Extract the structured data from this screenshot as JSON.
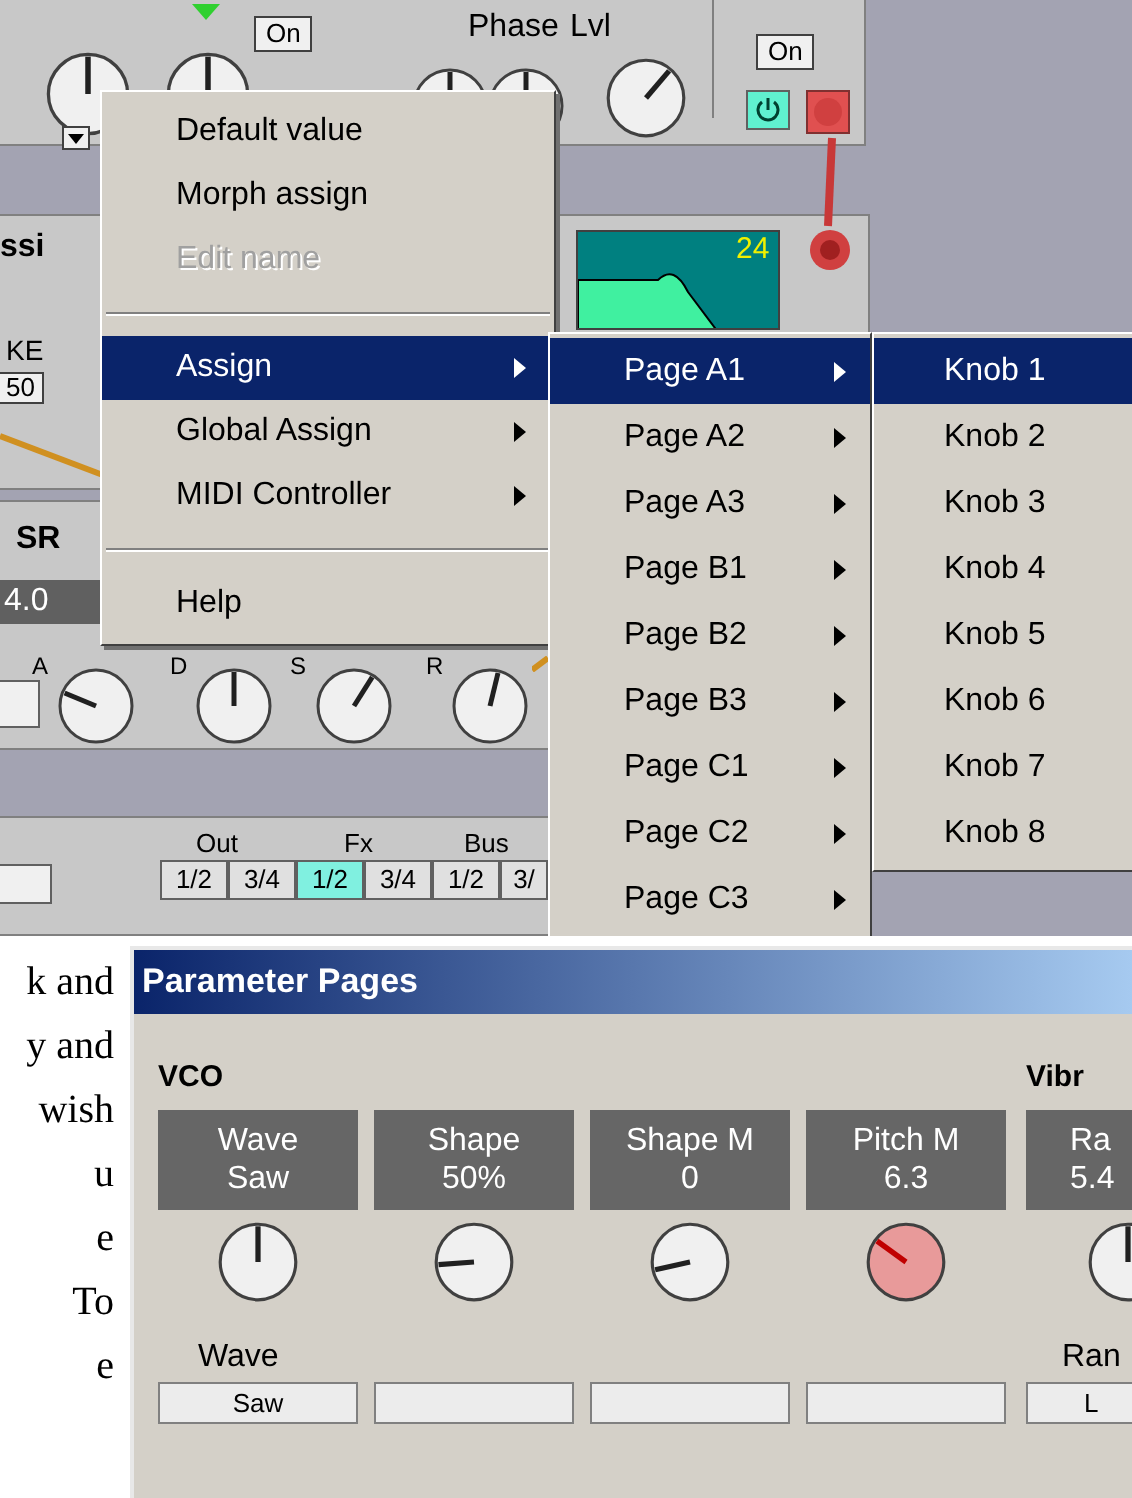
{
  "patch": {
    "osc_module": {
      "buttons": [
        {
          "label": "On"
        },
        {
          "label": "On"
        }
      ],
      "labels": [
        "Phase",
        "Lvl"
      ]
    },
    "env_module": {
      "title": "ssi",
      "label": "KE",
      "value": "50",
      "display": "24"
    },
    "adsr_module": {
      "title": "SR",
      "value": "4.0",
      "knob_labels": [
        "A",
        "D",
        "S",
        "R"
      ]
    },
    "output_module": {
      "groups": [
        "Out",
        "Fx",
        "Bus"
      ],
      "buttons": [
        {
          "label": "1/2",
          "selected": false
        },
        {
          "label": "3/4",
          "selected": false
        },
        {
          "label": "1/2",
          "selected": true
        },
        {
          "label": "3/4",
          "selected": false
        },
        {
          "label": "1/2",
          "selected": false
        },
        {
          "label": "3/",
          "selected": false
        }
      ]
    }
  },
  "context_menu": {
    "items": [
      {
        "kind": "item",
        "label": "Default value",
        "disabled": false,
        "selected": false,
        "submenu": false
      },
      {
        "kind": "item",
        "label": "Morph assign",
        "disabled": false,
        "selected": false,
        "submenu": false
      },
      {
        "kind": "item",
        "label": "Edit name",
        "disabled": true,
        "selected": false,
        "submenu": false
      },
      {
        "kind": "separator"
      },
      {
        "kind": "item",
        "label": "Assign",
        "disabled": false,
        "selected": true,
        "submenu": true
      },
      {
        "kind": "item",
        "label": "Global Assign",
        "disabled": false,
        "selected": false,
        "submenu": true
      },
      {
        "kind": "item",
        "label": "MIDI Controller",
        "disabled": false,
        "selected": false,
        "submenu": true
      },
      {
        "kind": "separator"
      },
      {
        "kind": "item",
        "label": "Help",
        "disabled": false,
        "selected": false,
        "submenu": false
      }
    ]
  },
  "pages_menu": {
    "items": [
      {
        "label": "Page A1",
        "selected": true
      },
      {
        "label": "Page A2",
        "selected": false
      },
      {
        "label": "Page A3",
        "selected": false
      },
      {
        "label": "Page B1",
        "selected": false
      },
      {
        "label": "Page B2",
        "selected": false
      },
      {
        "label": "Page B3",
        "selected": false
      },
      {
        "label": "Page C1",
        "selected": false
      },
      {
        "label": "Page C2",
        "selected": false
      },
      {
        "label": "Page C3",
        "selected": false
      }
    ]
  },
  "knobs_menu": {
    "items": [
      {
        "label": "Knob 1",
        "selected": true
      },
      {
        "label": "Knob 2",
        "selected": false
      },
      {
        "label": "Knob 3",
        "selected": false
      },
      {
        "label": "Knob 4",
        "selected": false
      },
      {
        "label": "Knob 5",
        "selected": false
      },
      {
        "label": "Knob 6",
        "selected": false
      },
      {
        "label": "Knob 7",
        "selected": false
      },
      {
        "label": "Knob 8",
        "selected": false
      }
    ]
  },
  "document_text": [
    "k and",
    "y and",
    "wish",
    "u",
    "e",
    "To",
    "e"
  ],
  "parameter_pages": {
    "title": "Parameter Pages",
    "groups": [
      {
        "title": "VCO",
        "params": [
          {
            "name": "Wave",
            "value": "Saw",
            "highlighted": false,
            "control_label": "Wave",
            "control_value": "Saw"
          },
          {
            "name": "Shape",
            "value": "50%",
            "highlighted": false
          },
          {
            "name": "Shape M",
            "value": "0",
            "highlighted": false
          },
          {
            "name": "Pitch M",
            "value": "6.3",
            "highlighted": true
          }
        ]
      },
      {
        "title": "Vibr",
        "params": [
          {
            "name": "Ra",
            "value": "5.4",
            "highlighted": false,
            "control_label": "Ran",
            "control_value": "L"
          }
        ]
      }
    ]
  }
}
